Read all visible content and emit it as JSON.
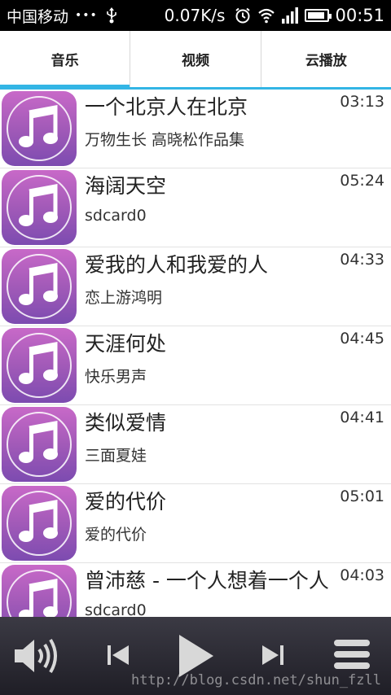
{
  "status_bar": {
    "carrier": "中国移动",
    "dots": "•••",
    "speed": "0.07K/s",
    "time": "00:51",
    "icons": [
      "usb-icon",
      "alarm-icon",
      "wifi-icon",
      "signal-icon",
      "battery-icon"
    ],
    "battery_level": 0.9
  },
  "tabs": [
    {
      "label": "音乐",
      "active": true
    },
    {
      "label": "视频",
      "active": false
    },
    {
      "label": "云播放",
      "active": false
    }
  ],
  "songs": [
    {
      "title": "一个北京人在北京",
      "artist": "万物生长 高晓松作品集",
      "duration": "03:13"
    },
    {
      "title": "海阔天空",
      "artist": "sdcard0",
      "duration": "05:24"
    },
    {
      "title": "爱我的人和我爱的人",
      "artist": "恋上游鸿明",
      "duration": "04:33"
    },
    {
      "title": "天涯何处",
      "artist": "快乐男声",
      "duration": "04:45"
    },
    {
      "title": "类似爱情",
      "artist": "三面夏娃",
      "duration": "04:41"
    },
    {
      "title": "爱的代价",
      "artist": "爱的代价",
      "duration": "05:01"
    },
    {
      "title": "曾沛慈 - 一个人想着一个人",
      "artist": "sdcard0",
      "duration": "04:03"
    }
  ],
  "player": {
    "icons": [
      "volume-icon",
      "previous-icon",
      "play-icon",
      "next-icon",
      "menu-icon"
    ],
    "watermark": "http://blog.csdn.net/shun_fzll"
  },
  "colors": {
    "accent": "#33b5e5",
    "album_top": "#c869c8",
    "album_bottom": "#7c4bb0"
  }
}
